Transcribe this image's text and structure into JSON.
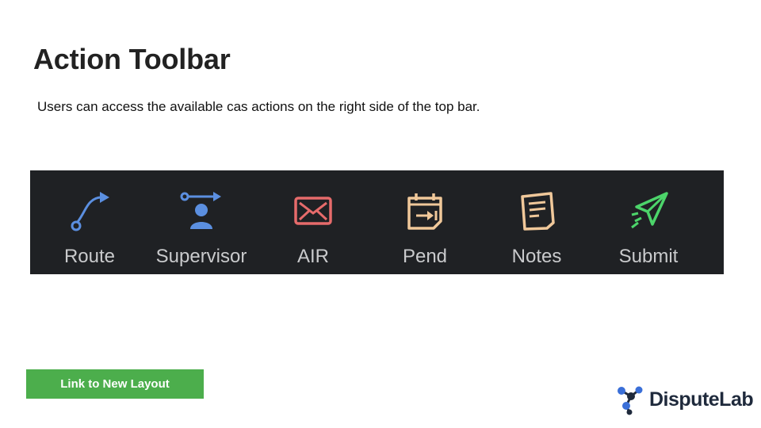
{
  "page": {
    "title": "Action Toolbar",
    "subtitle": "Users can access the available cas actions on the right side of the top bar."
  },
  "toolbar": {
    "items": [
      {
        "label": "Route",
        "icon": "route-icon",
        "color": "#5b8fe0"
      },
      {
        "label": "Supervisor",
        "icon": "supervisor-icon",
        "color": "#5b8fe0"
      },
      {
        "label": "AIR",
        "icon": "envelope-icon",
        "color": "#e66b6b"
      },
      {
        "label": "Pend",
        "icon": "calendar-pend-icon",
        "color": "#f0c89a"
      },
      {
        "label": "Notes",
        "icon": "notes-icon",
        "color": "#f0c89a"
      },
      {
        "label": "Submit",
        "icon": "paper-plane-icon",
        "color": "#4cd46a"
      }
    ]
  },
  "link_button": {
    "label": "Link to New Layout",
    "color": "#4cae4c"
  },
  "logo": {
    "text": "DisputeLab",
    "color": "#1f2a3c",
    "accent": "#3a6fd8"
  }
}
